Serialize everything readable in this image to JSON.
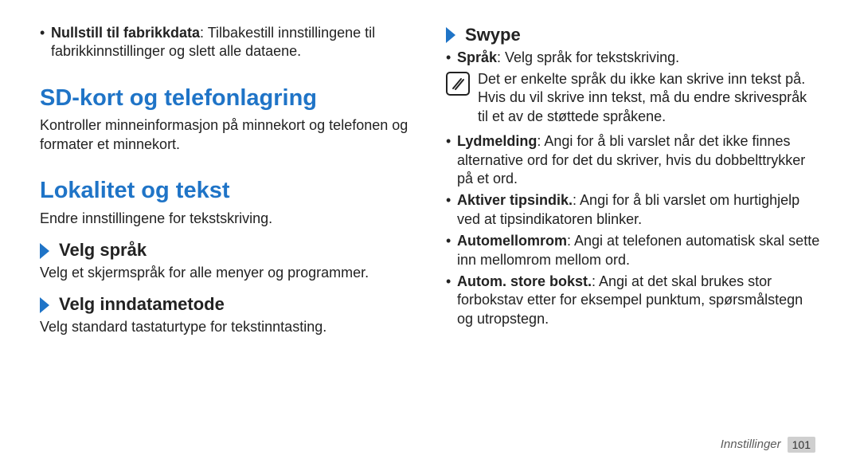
{
  "left": {
    "bullet1_bold": "Nullstill til fabrikkdata",
    "bullet1_text": ": Tilbakestill innstillingene til fabrikkinnstillinger og slett alle dataene.",
    "h1_sd": "SD-kort og telefonlagring",
    "sd_para": "Kontroller minneinformasjon på minnekort og telefonen og formater et minnekort.",
    "h1_locale": "Lokalitet og tekst",
    "locale_para": "Endre innstillingene for tekstskriving.",
    "sub_lang": "Velg språk",
    "lang_para": "Velg et skjermspråk for alle menyer og programmer.",
    "sub_input": "Velg inndatametode",
    "input_para": "Velg standard tastaturtype for tekstinntasting."
  },
  "right": {
    "sub_swype": "Swype",
    "b_sprak_bold": "Språk",
    "b_sprak_text": ": Velg språk for tekstskriving.",
    "note_text": "Det er enkelte språk du ikke kan skrive inn tekst på. Hvis du vil skrive inn tekst, må du endre skrivespråk til et av de støttede språkene.",
    "b_lyd_bold": "Lydmelding",
    "b_lyd_text": ": Angi for å bli varslet når det ikke finnes alternative ord for det du skriver, hvis du dobbelttrykker på et ord.",
    "b_tips_bold": "Aktiver tipsindik.",
    "b_tips_text": ": Angi for å bli varslet om hurtighjelp ved at tipsindikatoren blinker.",
    "b_auto_bold": "Automellomrom",
    "b_auto_text": ": Angi at telefonen automatisk skal sette inn mellomrom mellom ord.",
    "b_caps_bold": "Autom. store bokst.",
    "b_caps_text": ": Angi at det skal brukes stor forbokstav etter for eksempel punktum, spørsmålstegn og utropstegn."
  },
  "footer": {
    "section": "Innstillinger",
    "page": "101"
  }
}
